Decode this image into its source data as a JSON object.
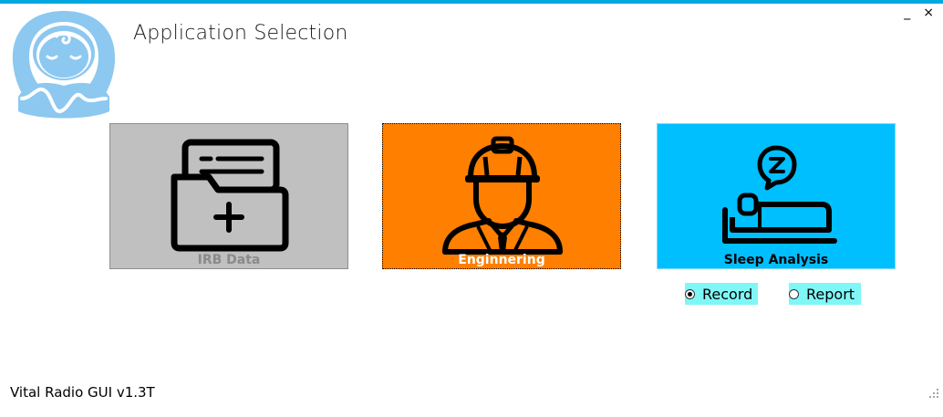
{
  "window": {
    "title": "Application Selection",
    "minimize_glyph": "_",
    "close_glyph": "×",
    "accent_color": "#00a8e0"
  },
  "tiles": [
    {
      "label": "IRB Data",
      "icon": "folder-plus-icon",
      "color": "#c0c0c0",
      "label_color": "#8a8a8a"
    },
    {
      "label": "Enginnering",
      "icon": "engineer-icon",
      "color": "#ff7f00",
      "label_color": "#ffffff"
    },
    {
      "label": "Sleep Analysis",
      "icon": "sleeping-person-icon",
      "color": "#00bfff",
      "label_color": "#000000"
    }
  ],
  "sleep_options": {
    "selected": "Record",
    "options": [
      {
        "label": "Record",
        "checked": true
      },
      {
        "label": "Report",
        "checked": false
      }
    ],
    "highlight_color": "#7ff7f7"
  },
  "footer": {
    "version": "Vital Radio GUI v1.3T"
  },
  "logo": {
    "icon": "baby-logo-icon",
    "color": "#8cc8f0"
  }
}
